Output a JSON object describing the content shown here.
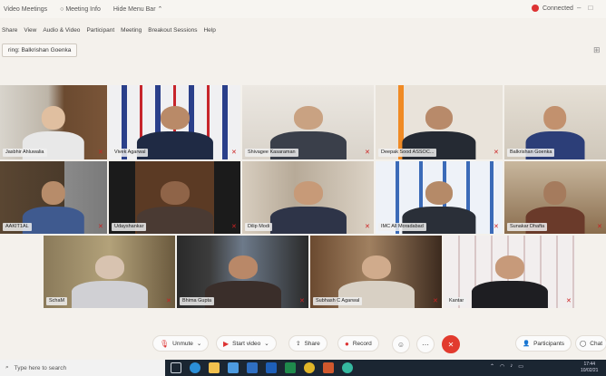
{
  "titlebar": {
    "items": [
      "Video Meetings",
      "Meeting Info",
      "Hide Menu Bar"
    ],
    "status": "Connected",
    "controls": [
      "–",
      "□"
    ]
  },
  "menubar": {
    "items": [
      "Share",
      "View",
      "Audio & Video",
      "Participant",
      "Meeting",
      "Breakout Sessions",
      "Help"
    ]
  },
  "spotlight": {
    "label": "ring: Balkrishan Goenka"
  },
  "participants": [
    {
      "name": "Jasbhir Ahluwalia"
    },
    {
      "name": "Vivek Agarwal"
    },
    {
      "name": "Shivagee Kasaraman"
    },
    {
      "name": "Deepak Sood ASSOC..."
    },
    {
      "name": "Balkrishan Goenka"
    },
    {
      "name": "AAKIT1AL"
    },
    {
      "name": "Udayshankar"
    },
    {
      "name": "Dilip Modi"
    },
    {
      "name": "IMC All Moradabad"
    },
    {
      "name": "Sunakar Dhafta"
    },
    {
      "name": "SchaM"
    },
    {
      "name": "Bhima Gupta"
    },
    {
      "name": "Subhash C Agarwal"
    },
    {
      "name": "Kantar"
    }
  ],
  "controls": {
    "unmute": "Unmute",
    "start_video": "Start video",
    "share": "Share",
    "record": "Record",
    "participants": "Participants",
    "chat": "Chat"
  },
  "taskbar": {
    "search_placeholder": "Type here to search",
    "clock_time": "17:44",
    "clock_date": "10/02/21"
  },
  "colors": {
    "accent_red": "#e23b2e",
    "active_speaker": "#55d3e0",
    "taskbar": "#1b2632"
  }
}
